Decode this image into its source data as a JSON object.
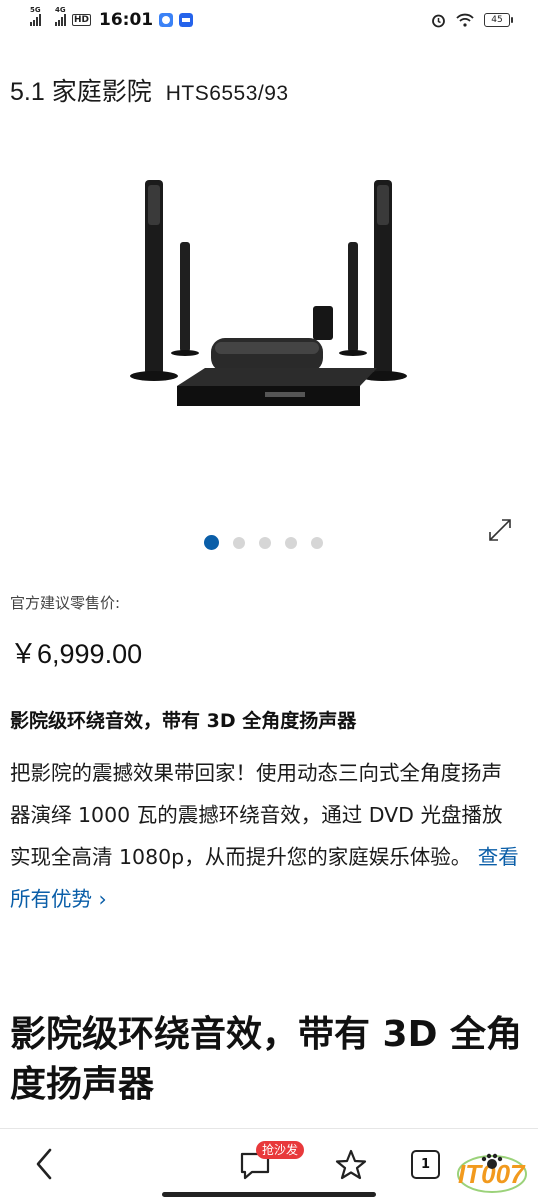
{
  "status_bar": {
    "signal1": "5G",
    "signal2": "4G",
    "hd": "HD",
    "time": "16:01",
    "battery": "45"
  },
  "product": {
    "title": "5.1 家庭影院",
    "model": "HTS6553/93",
    "image_alt": "Philips 5.1 home theater speakers and DVD player",
    "carousel": {
      "total": 5,
      "active_index": 0
    }
  },
  "pricing": {
    "label": "官方建议零售价:",
    "price": "￥6,999.00"
  },
  "feature": {
    "heading": "影院级环绕音效，带有 3D 全角度扬声器",
    "description": "把影院的震撼效果带回家！使用动态三向式全角度扬声器演绎 1000 瓦的震撼环绕音效，通过 DVD 光盘播放实现全高清 1080p，从而提升您的家庭娱乐体验。",
    "link": "查看所有优势 ›"
  },
  "section": {
    "heading": "影院级环绕音效，带有 3D 全角度扬声器"
  },
  "bottom_nav": {
    "comment_badge": "抢沙发",
    "tabs_count": "1",
    "watermark": "IT007",
    "icons": [
      "back-icon",
      "comment-icon",
      "star-icon",
      "tabs-icon",
      "paw-icon"
    ]
  },
  "colors": {
    "accent": "#0a5ea8",
    "badge": "#e8393b",
    "watermark_orange": "#f29a1e"
  }
}
